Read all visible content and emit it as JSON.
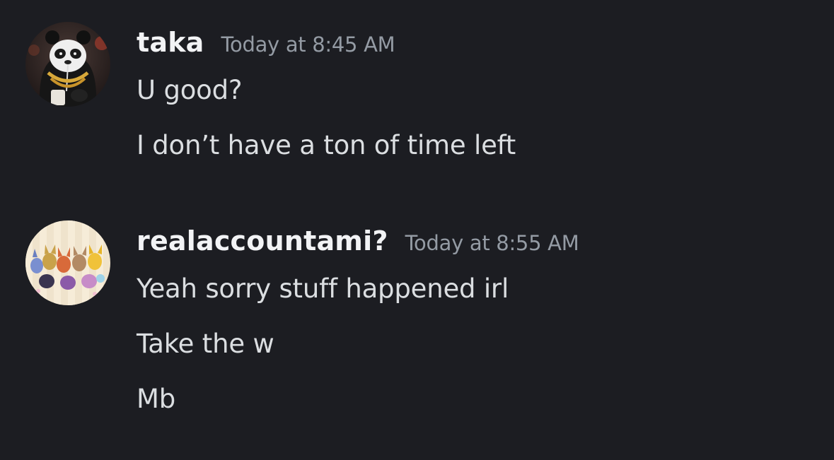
{
  "messages": [
    {
      "username": "taka",
      "timestamp": "Today at 8:45 AM",
      "avatar_icon": "panda-avatar-icon",
      "lines": [
        "U good?",
        "I don’t have a ton of time left"
      ]
    },
    {
      "username": "realaccountami?",
      "timestamp": "Today at 8:55 AM",
      "avatar_icon": "eevee-avatar-icon",
      "lines": [
        "Yeah sorry stuff happened irl",
        "Take the w",
        "Mb"
      ]
    }
  ],
  "colors": {
    "background": "#1c1d22",
    "username": "#f2f3f5",
    "timestamp": "#949ba4",
    "message_text": "#dbdee1"
  }
}
